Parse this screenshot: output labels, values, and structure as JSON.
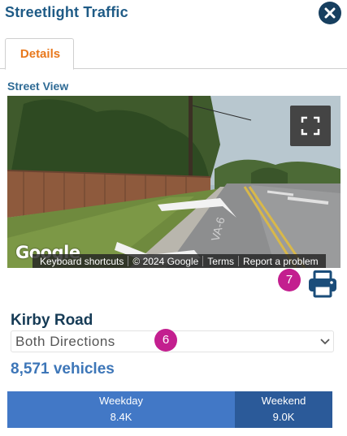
{
  "panel": {
    "title": "Streetlight Traffic"
  },
  "tabs": [
    {
      "label": "Details",
      "active": true
    }
  ],
  "street_view": {
    "section_label": "Street View",
    "logo": "Google",
    "attribution": [
      "Keyboard shortcuts",
      "© 2024 Google",
      "Terms",
      "Report a problem"
    ]
  },
  "markers": {
    "print": "7",
    "direction": "6"
  },
  "road": {
    "name": "Kirby Road",
    "direction_selected": "Both Directions",
    "vehicles": "8,571 vehicles"
  },
  "breakdown": [
    {
      "label": "Weekday",
      "value": "8.4K",
      "share": 0.7
    },
    {
      "label": "Weekend",
      "value": "9.0K",
      "share": 0.3
    }
  ],
  "colors": {
    "title": "#1f5b86",
    "tab_active": "#e8781c",
    "marker": "#c31f8f",
    "weekday": "#4278c6",
    "weekend": "#2b5a99"
  },
  "icons": {
    "close": "close-icon",
    "fullscreen": "fullscreen-icon",
    "print": "printer-icon",
    "select": "chevron-down-icon"
  }
}
